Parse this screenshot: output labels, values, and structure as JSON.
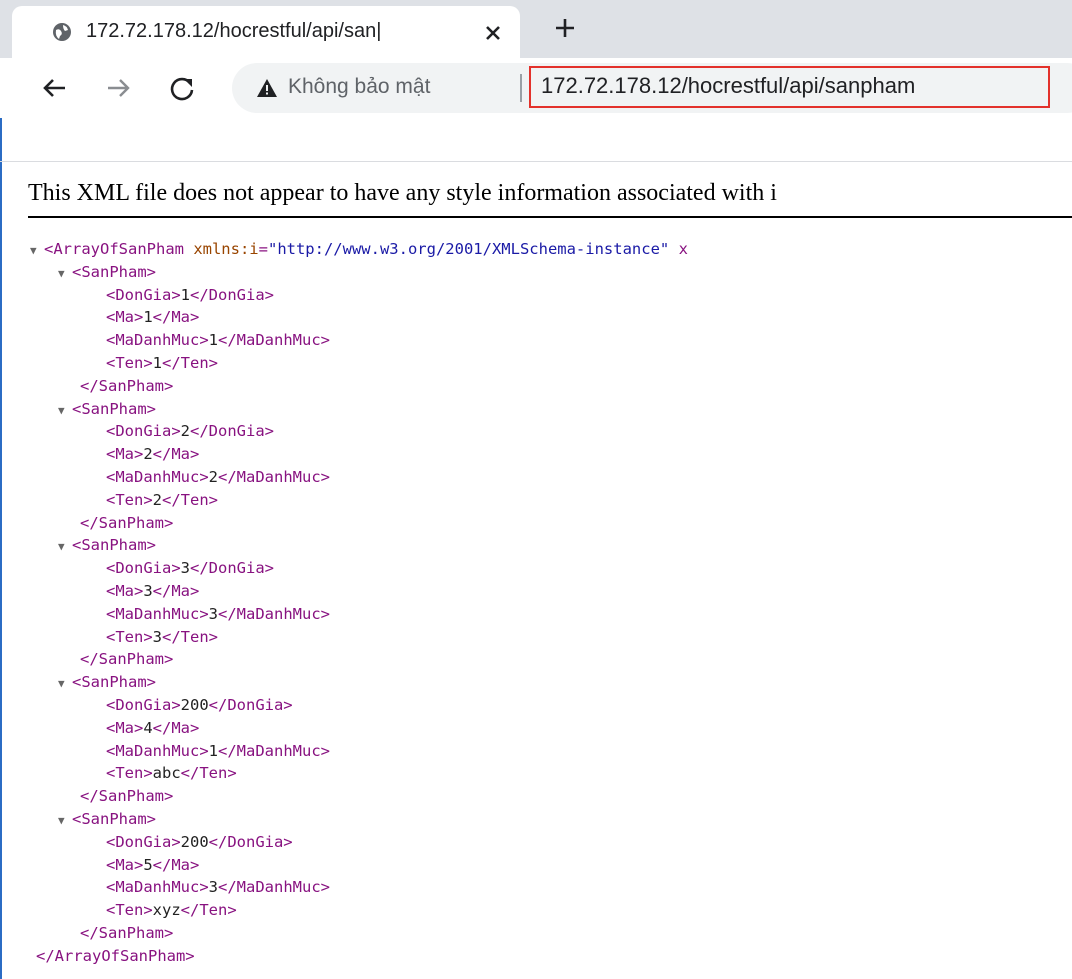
{
  "browser": {
    "tab": {
      "title": "172.72.178.12/hocrestful/api/san|",
      "favicon": "globe-icon",
      "close_icon": "close-icon"
    },
    "new_tab_icon": "plus-icon",
    "toolbar": {
      "back_icon": "arrow-left-icon",
      "forward_icon": "arrow-right-icon",
      "reload_icon": "reload-icon",
      "security_icon": "warning-triangle-icon",
      "security_label": "Không bảo mật",
      "url": "172.72.178.12/hocrestful/api/sanpham",
      "highlight_color": "#e3312b"
    }
  },
  "page": {
    "xml_note": "This XML file does not appear to have any style information associated with i",
    "root": {
      "open_prefix": "<ArrayOfSanPham ",
      "attr_name": "xmlns:i",
      "attr_eq": "=",
      "attr_value": "\"http://www.w3.org/2001/XMLSchema-instance\"",
      "attr_tail": " x",
      "close": "</ArrayOfSanPham>"
    },
    "item_open": "<SanPham>",
    "item_close": "</SanPham>",
    "items": [
      {
        "DonGia": "1",
        "Ma": "1",
        "MaDanhMuc": "1",
        "Ten": "1"
      },
      {
        "DonGia": "2",
        "Ma": "2",
        "MaDanhMuc": "2",
        "Ten": "2"
      },
      {
        "DonGia": "3",
        "Ma": "3",
        "MaDanhMuc": "3",
        "Ten": "3"
      },
      {
        "DonGia": "200",
        "Ma": "4",
        "MaDanhMuc": "1",
        "Ten": "abc"
      },
      {
        "DonGia": "200",
        "Ma": "5",
        "MaDanhMuc": "3",
        "Ten": "xyz"
      }
    ],
    "toggle_glyph": "▼"
  }
}
